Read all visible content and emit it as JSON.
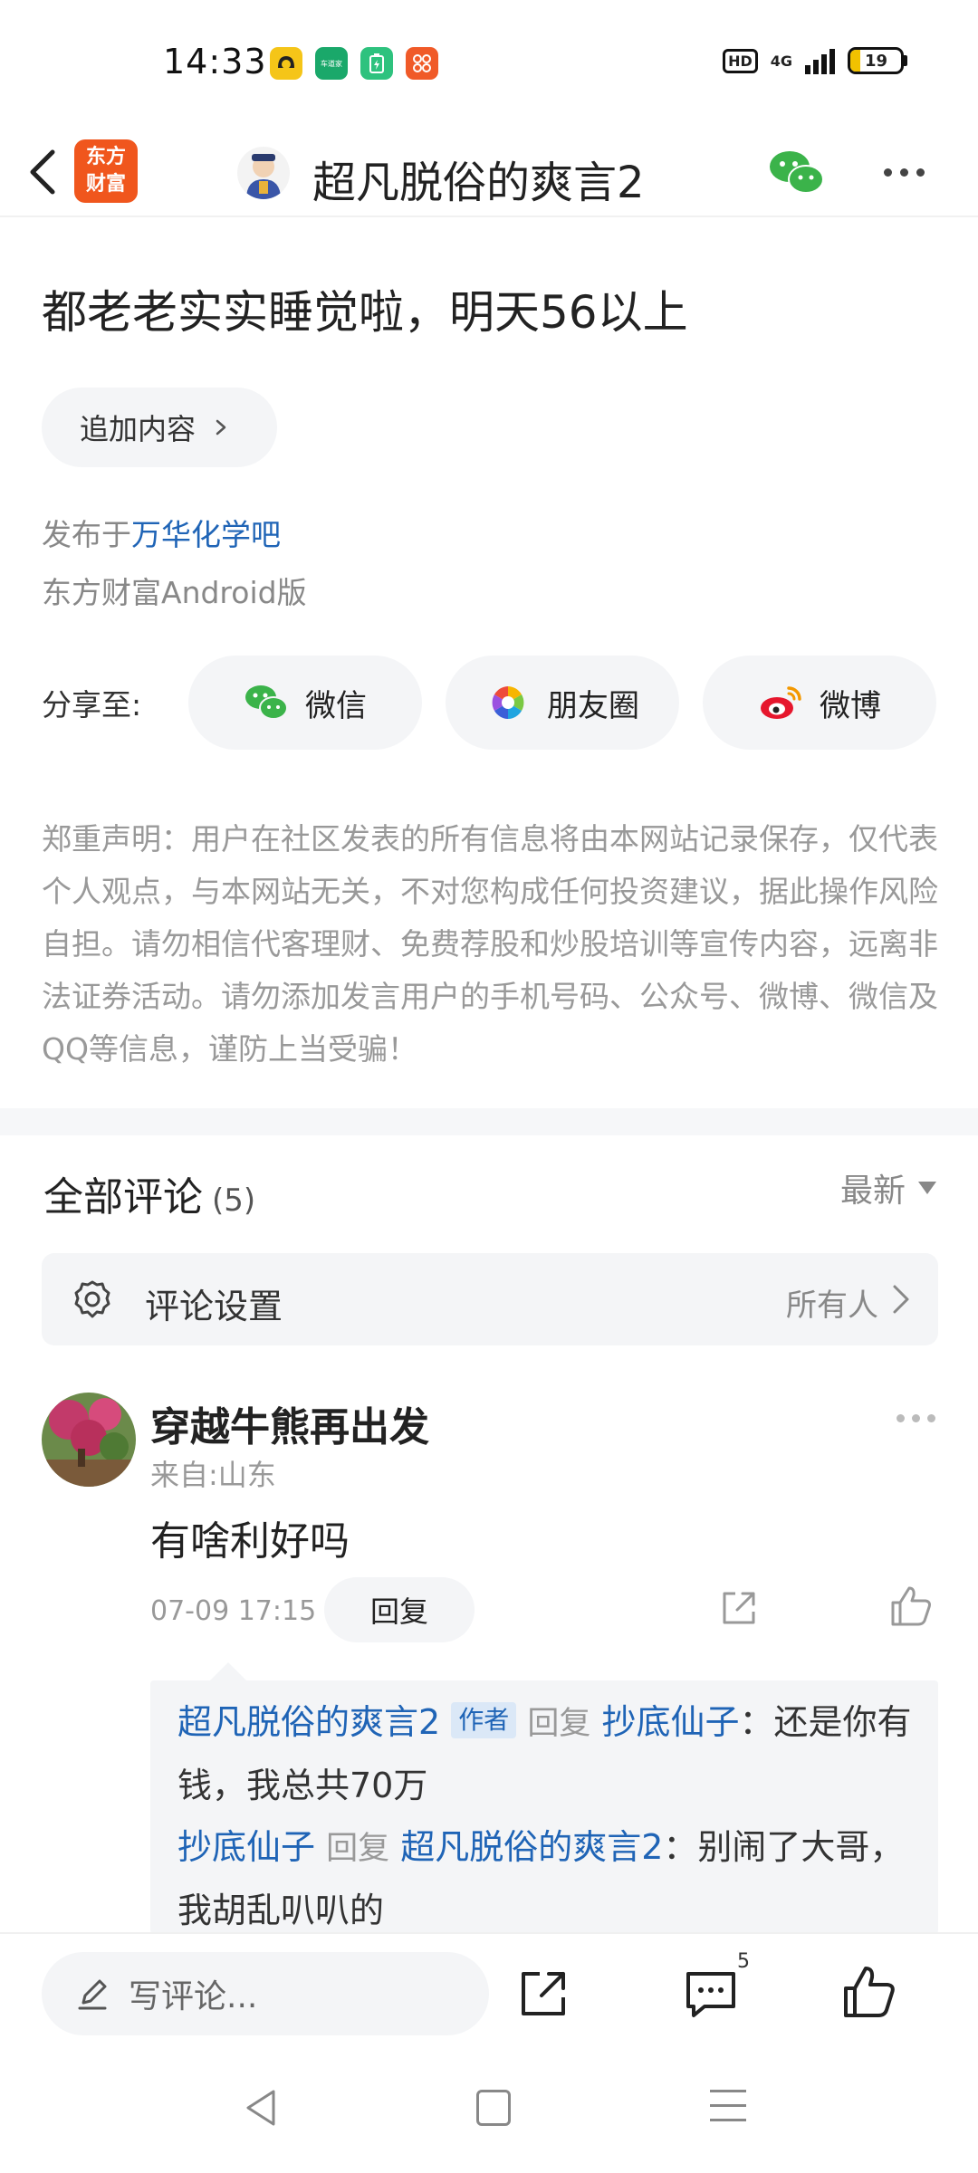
{
  "status_bar": {
    "time": "14:33",
    "battery_level": "19",
    "network": "4G",
    "hd": "HD",
    "app_icons": [
      "robot-app-icon",
      "chedaojia-app-icon",
      "battery-saver-app-icon",
      "grid-app-icon"
    ],
    "app_icon_label": "车道家"
  },
  "header": {
    "logo_text_line1": "东方",
    "logo_text_line2": "财富",
    "title": "超凡脱俗的爽言2"
  },
  "post": {
    "title": "都老老实实睡觉啦，明天56以上",
    "append_label": "追加内容",
    "published_prefix": "发布于",
    "forum_name": "万华化学吧",
    "platform": "东方财富Android版"
  },
  "share": {
    "label": "分享至:",
    "targets": [
      {
        "label": "微信",
        "icon": "wechat-icon"
      },
      {
        "label": "朋友圈",
        "icon": "moments-icon"
      },
      {
        "label": "微博",
        "icon": "weibo-icon"
      }
    ]
  },
  "disclaimer": "郑重声明：用户在社区发表的所有信息将由本网站记录保存，仅代表个人观点，与本网站无关，不对您构成任何投资建议，据此操作风险自担。请勿相信代客理财、免费荐股和炒股培训等宣传内容，远离非法证券活动。请勿添加发言用户的手机号码、公众号、微博、微信及QQ等信息，谨防上当受骗！",
  "comments_section": {
    "title": "全部评论",
    "count": "(5)",
    "sort_label": "最新",
    "settings_label": "评论设置",
    "settings_value": "所有人"
  },
  "comment": {
    "username": "穿越牛熊再出发",
    "location": "来自:山东",
    "text": "有啥利好吗",
    "time": "07-09 17:15",
    "reply_label": "回复",
    "replies": [
      {
        "from": "超凡脱俗的爽言2",
        "tag": "作者",
        "verb": "回复",
        "to": "抄底仙子",
        "text": "：还是你有钱，我总共70万"
      },
      {
        "from": "抄底仙子",
        "verb": "回复",
        "to": "超凡脱俗的爽言2",
        "text": "：别闹了大哥，我胡乱叭叭的"
      }
    ]
  },
  "bottom_bar": {
    "write_placeholder": "写评论...",
    "comment_badge": "5"
  },
  "colors": {
    "brand_orange": "#f0561d",
    "link_blue": "#1f64b6",
    "wechat_green": "#3bb34a",
    "weibo_red": "#e6162d"
  }
}
